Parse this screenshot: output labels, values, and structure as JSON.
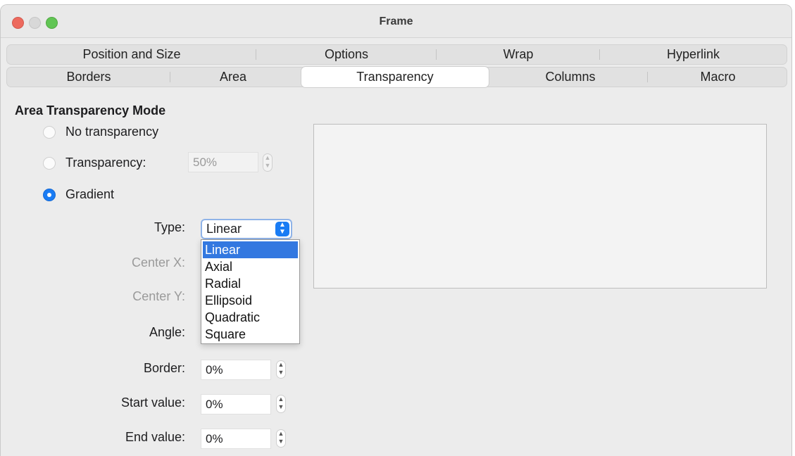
{
  "window": {
    "title": "Frame"
  },
  "tabs_row1": [
    {
      "label": "Position and Size"
    },
    {
      "label": "Options"
    },
    {
      "label": "Wrap"
    },
    {
      "label": "Hyperlink"
    }
  ],
  "tabs_row2": [
    {
      "label": "Borders"
    },
    {
      "label": "Area"
    },
    {
      "label": "Transparency",
      "active": true
    },
    {
      "label": "Columns"
    },
    {
      "label": "Macro"
    }
  ],
  "section": {
    "title": "Area Transparency Mode"
  },
  "modes": {
    "no_transparency": "No transparency",
    "transparency": "Transparency:",
    "transparency_value": "50%",
    "gradient": "Gradient",
    "selected": "gradient"
  },
  "gradient": {
    "type_label": "Type:",
    "type_value": "Linear",
    "center_x_label": "Center X:",
    "center_y_label": "Center Y:",
    "angle_label": "Angle:",
    "border_label": "Border:",
    "border_value": "0%",
    "start_label": "Start value:",
    "start_value": "0%",
    "end_label": "End value:",
    "end_value": "0%"
  },
  "type_options": [
    "Linear",
    "Axial",
    "Radial",
    "Ellipsoid",
    "Quadratic",
    "Square"
  ],
  "type_selected_index": 0,
  "colors": {
    "accent": "#1a7cf4",
    "selection": "#3378e0",
    "close": "#ed6a5e",
    "minimize": "#d8d8d8",
    "maximize": "#61c554"
  }
}
